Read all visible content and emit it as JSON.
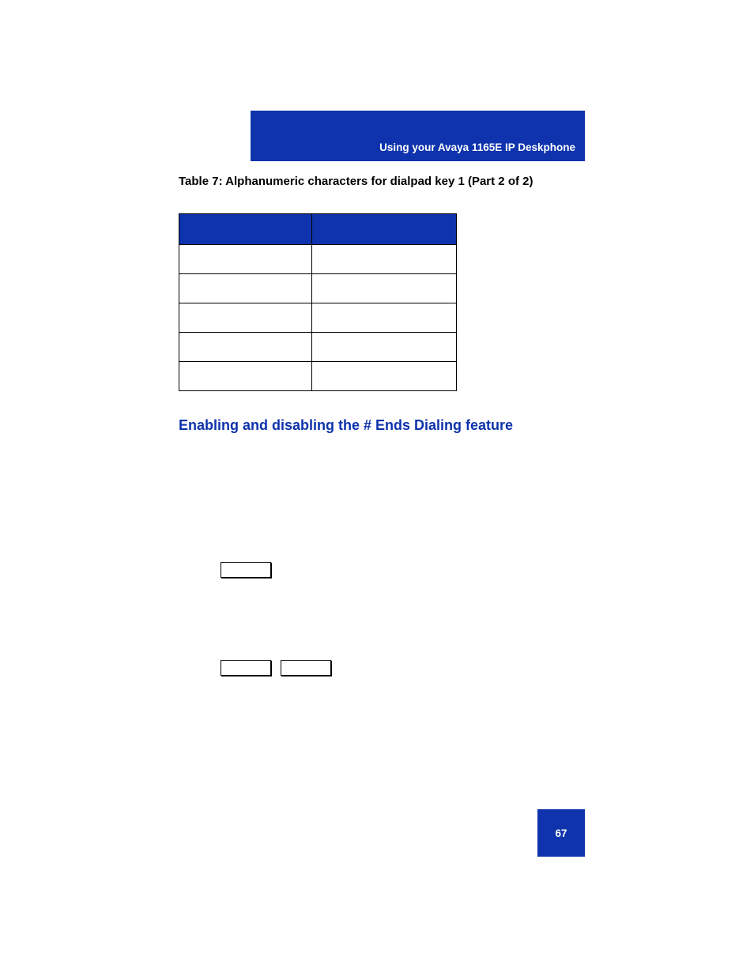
{
  "header": {
    "title": "Using your Avaya 1165E IP Deskphone"
  },
  "table_caption": "Table 7: Alphanumeric characters for dialpad key 1 (Part 2 of 2)",
  "section_heading": "Enabling and disabling the # Ends Dialing feature",
  "footer": {
    "page_number": "67"
  }
}
